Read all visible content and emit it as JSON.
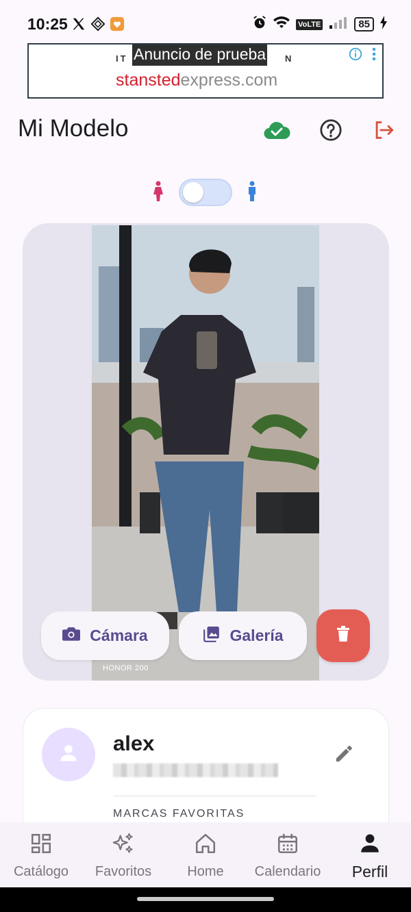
{
  "status_bar": {
    "time": "10:25",
    "network": "VoLTE",
    "battery": "85"
  },
  "ad": {
    "label": "Anuncio de prueba",
    "tag_left": "IT",
    "tag_right": "N",
    "domain_red": "stansted",
    "domain_gray": "express.com"
  },
  "header": {
    "title": "Mi Modelo"
  },
  "photo": {
    "watermark": "HONOR 200"
  },
  "actions": {
    "camera_label": "Cámara",
    "gallery_label": "Galería"
  },
  "profile": {
    "name": "alex",
    "favorites_label": "MARCAS FAVORITAS"
  },
  "nav": {
    "items": [
      {
        "label": "Catálogo",
        "icon": "catalog-grid-icon"
      },
      {
        "label": "Favoritos",
        "icon": "sparkles-icon"
      },
      {
        "label": "Home",
        "icon": "home-icon"
      },
      {
        "label": "Calendario",
        "icon": "calendar-icon"
      },
      {
        "label": "Perfil",
        "icon": "person-icon",
        "active": true
      }
    ]
  },
  "colors": {
    "accent": "#5a4a8e",
    "delete": "#e45d55",
    "cloud_ok": "#2e9b57",
    "logout": "#d4533f",
    "female": "#d5366b",
    "male": "#3b82d9"
  }
}
